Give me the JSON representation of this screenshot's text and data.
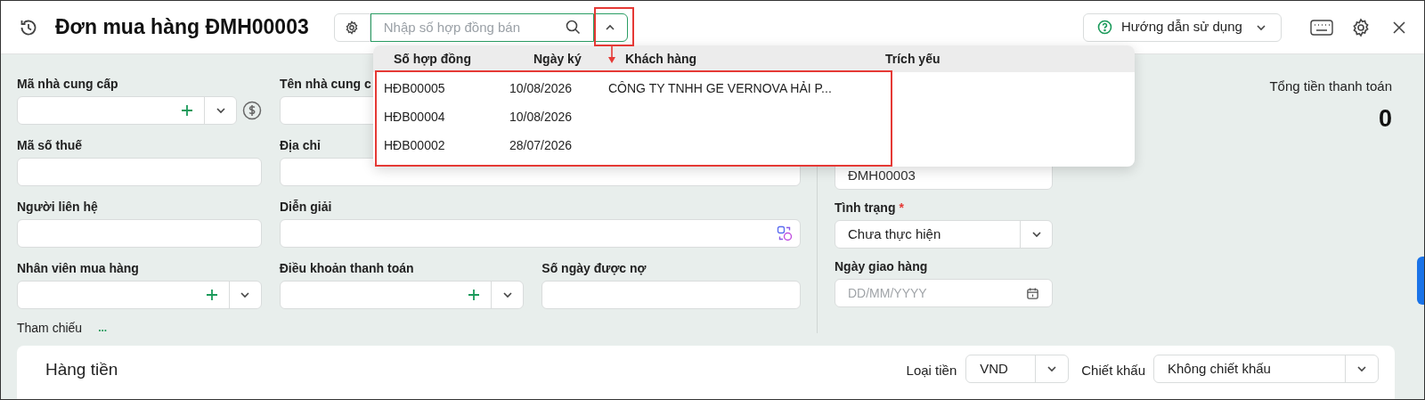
{
  "header": {
    "title": "Đơn mua hàng ĐMH00003",
    "search": {
      "placeholder": "Nhập số hợp đồng bán"
    },
    "help_button": "Hướng dẫn sử dụng"
  },
  "contract_dropdown": {
    "expanded": true,
    "columns": [
      "Số hợp đồng",
      "Ngày ký",
      "Khách hàng",
      "Trích yếu"
    ],
    "rows": [
      {
        "contract_no": "HĐB00005",
        "date": "10/08/2026",
        "customer": "CÔNG TY TNHH GE VERNOVA HẢI P..."
      },
      {
        "contract_no": "HĐB00004",
        "date": "10/08/2026"
      },
      {
        "contract_no": "HĐB00002",
        "date": "28/07/2026"
      }
    ]
  },
  "form": {
    "rows": [
      [
        {
          "label": "Mã nhà cung cấp",
          "kind": "combo-money"
        },
        {
          "label": "Tên nhà cung c",
          "kind": "text"
        }
      ],
      [
        {
          "label": "Mã số thuế",
          "kind": "text"
        },
        {
          "label": "Địa chỉ",
          "kind": "text"
        }
      ],
      [
        {
          "label": "Người liên hệ",
          "kind": "text"
        },
        {
          "label": "Diễn giải",
          "kind": "ai-text"
        }
      ],
      [
        {
          "label": "Nhân viên mua hàng",
          "kind": "combo"
        },
        {
          "label": "Điều khoản thanh toán",
          "kind": "combo"
        },
        {
          "label": "Số ngày được nợ",
          "kind": "text"
        }
      ]
    ],
    "right_fields": [
      {
        "kind": "text",
        "value": "ĐMH00003"
      },
      {
        "label": "Tình trạng",
        "required_mark": "*",
        "kind": "select",
        "value": "Chưa thực hiện"
      },
      {
        "label": "Ngày giao hàng",
        "kind": "date",
        "placeholder": "DD/MM/YYYY"
      }
    ],
    "total": {
      "label": "Tổng tiền thanh toán",
      "value": "0"
    },
    "reference": {
      "label": "Tham chiếu",
      "more": "..."
    }
  },
  "amounts_card": {
    "title": "Hàng tiền",
    "currency": {
      "label": "Loại tiền",
      "value": "VND"
    },
    "discount": {
      "label": "Chiết khấu",
      "value": "Không chiết khấu"
    }
  }
}
